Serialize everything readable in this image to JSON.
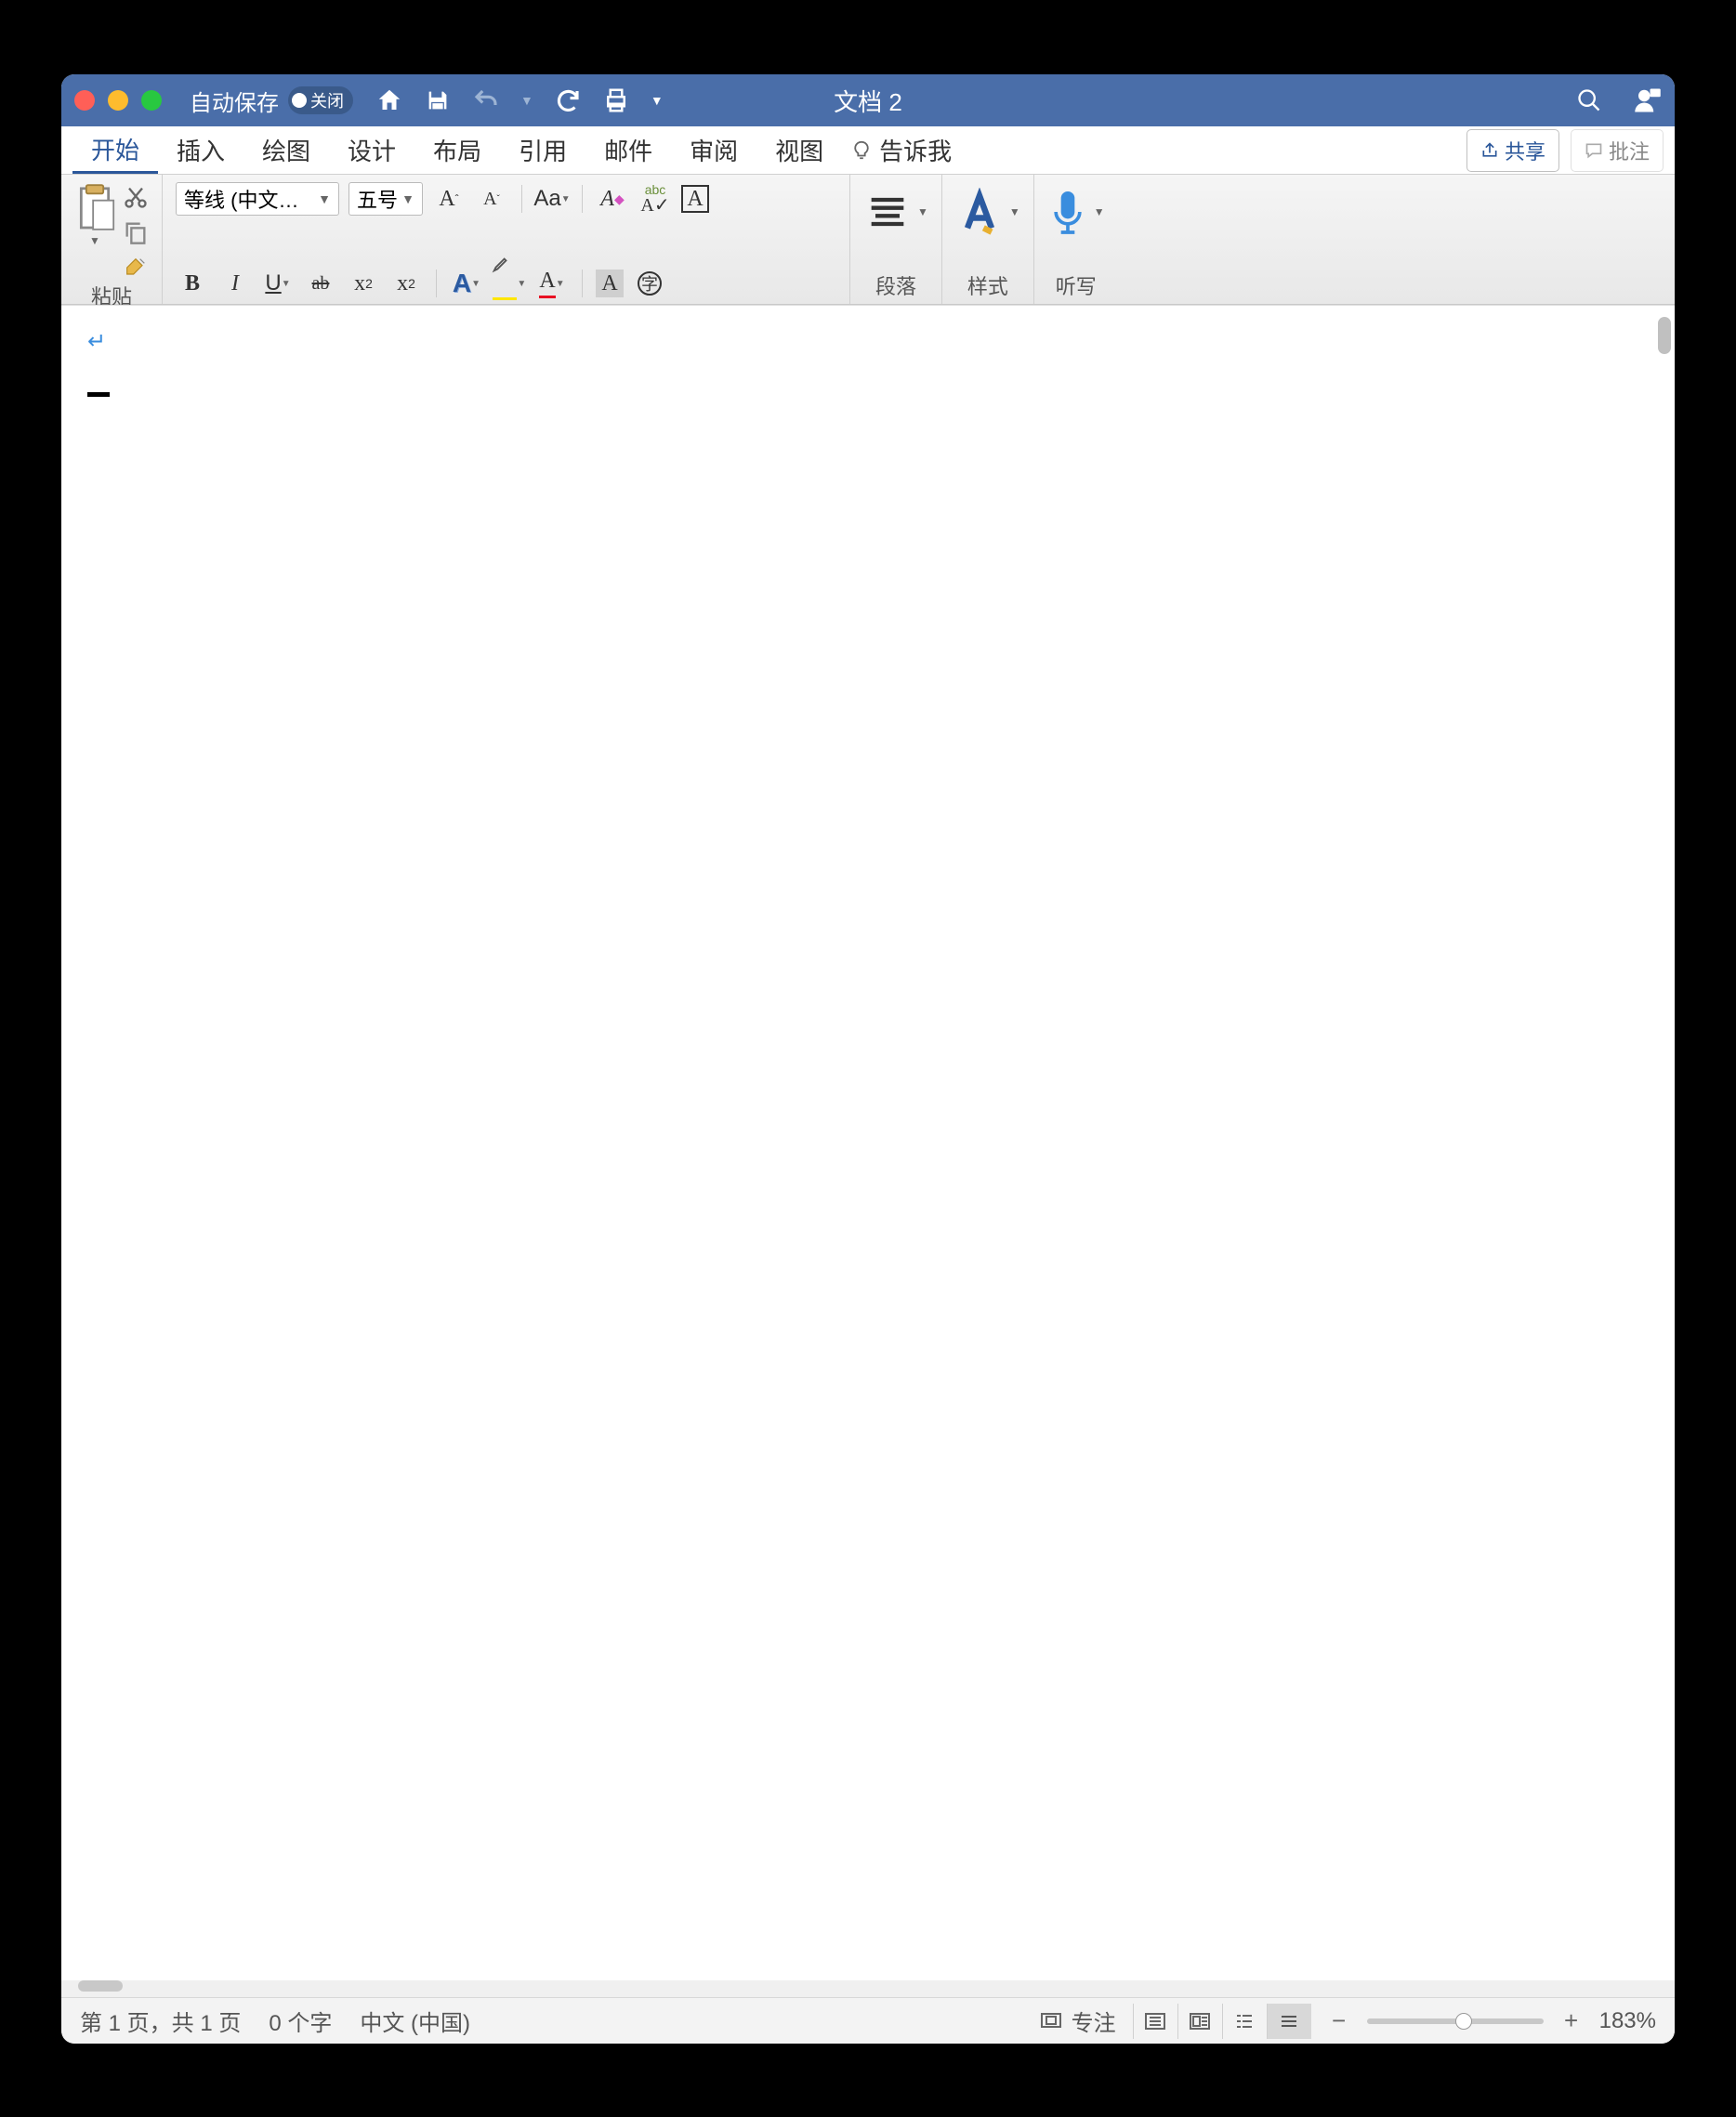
{
  "titlebar": {
    "autosave_label": "自动保存",
    "autosave_state": "关闭",
    "document_title": "文档 2"
  },
  "tabs": {
    "items": [
      "开始",
      "插入",
      "绘图",
      "设计",
      "布局",
      "引用",
      "邮件",
      "审阅",
      "视图"
    ],
    "tell_me": "告诉我",
    "share": "共享",
    "comments": "批注"
  },
  "ribbon": {
    "clipboard_label": "粘贴",
    "font_name": "等线 (中文…",
    "font_size": "五号",
    "case_label": "Aa",
    "paragraph_label": "段落",
    "styles_label": "样式",
    "dictate_label": "听写"
  },
  "statusbar": {
    "page_info": "第 1 页，共 1 页",
    "word_count": "0 个字",
    "language": "中文 (中国)",
    "focus": "专注",
    "zoom": "183%"
  }
}
